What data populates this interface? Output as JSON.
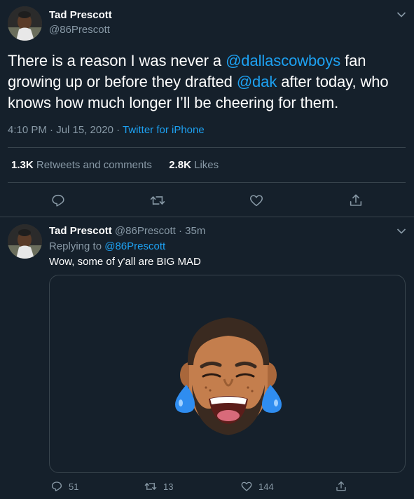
{
  "tweet": {
    "author_name": "Tad Prescott",
    "author_handle": "@86Prescott",
    "text_part1": "There is a reason I was never a ",
    "mention1": "@dallascowboys",
    "text_part2": "  fan growing up or before they drafted ",
    "mention2": "@dak",
    "text_part3": " after today, who knows how much longer I’ll be cheering for them.",
    "timestamp": "4:10 PM · Jul 15, 2020 · ",
    "source": "Twitter for iPhone",
    "retweets_count": "1.3K",
    "retweets_label": " Retweets and comments",
    "likes_count": "2.8K",
    "likes_label": " Likes"
  },
  "reply": {
    "author_name": "Tad Prescott",
    "author_handle_time": " @86Prescott · 35m",
    "replying_prefix": "Replying to ",
    "replying_handle": "@86Prescott",
    "text": "Wow, some of y'all are BIG MAD",
    "reply_count": "51",
    "retweet_count": "13",
    "like_count": "144"
  },
  "icons": {
    "reply": "speech-bubble-icon",
    "retweet": "retweet-arrows-icon",
    "like": "heart-icon",
    "share": "share-upload-icon",
    "menu": "chevron-down-icon"
  },
  "colors": {
    "background": "#15202b",
    "text": "#ffffff",
    "muted": "#8899a6",
    "link": "#1da1f2",
    "border": "#38444d"
  }
}
